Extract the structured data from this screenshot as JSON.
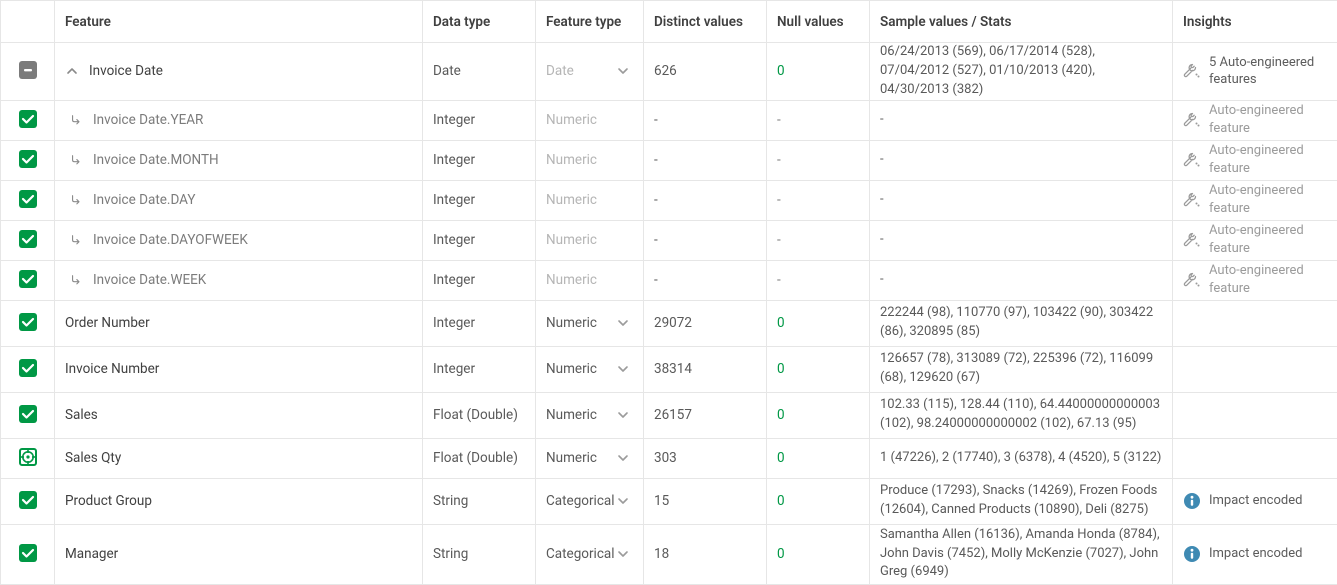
{
  "columns": {
    "feature": "Feature",
    "datatype": "Data type",
    "featuretype": "Feature type",
    "distinct": "Distinct values",
    "nulls": "Null values",
    "sample": "Sample values / Stats",
    "insights": "Insights"
  },
  "rows": [
    {
      "kind": "parent",
      "check": "indeterminate",
      "feature": "Invoice Date",
      "datatype": "Date",
      "featuretype": "Date",
      "ft_disabled": true,
      "ft_chevron": true,
      "distinct": "626",
      "nulls": "0",
      "sample": "06/24/2013 (569), 06/17/2014 (528), 07/04/2012 (527), 01/10/2013 (420), 04/30/2013 (382)",
      "insight": {
        "icon": "wrench",
        "text": "5 Auto-engineered features"
      },
      "rowcls": "tall"
    },
    {
      "kind": "child",
      "check": "checked",
      "feature": "Invoice Date.YEAR",
      "datatype": "Integer",
      "featuretype": "Numeric",
      "ft_disabled": true,
      "ft_chevron": false,
      "distinct": "-",
      "nulls": "-",
      "sample": "-",
      "insight": {
        "icon": "wrench",
        "text": "Auto-engineered feature",
        "dim": true
      },
      "dimrow": true
    },
    {
      "kind": "child",
      "check": "checked",
      "feature": "Invoice Date.MONTH",
      "datatype": "Integer",
      "featuretype": "Numeric",
      "ft_disabled": true,
      "ft_chevron": false,
      "distinct": "-",
      "nulls": "-",
      "sample": "-",
      "insight": {
        "icon": "wrench",
        "text": "Auto-engineered feature",
        "dim": true
      },
      "dimrow": true
    },
    {
      "kind": "child",
      "check": "checked",
      "feature": "Invoice Date.DAY",
      "datatype": "Integer",
      "featuretype": "Numeric",
      "ft_disabled": true,
      "ft_chevron": false,
      "distinct": "-",
      "nulls": "-",
      "sample": "-",
      "insight": {
        "icon": "wrench",
        "text": "Auto-engineered feature",
        "dim": true
      },
      "dimrow": true
    },
    {
      "kind": "child",
      "check": "checked",
      "feature": "Invoice Date.DAYOFWEEK",
      "datatype": "Integer",
      "featuretype": "Numeric",
      "ft_disabled": true,
      "ft_chevron": false,
      "distinct": "-",
      "nulls": "-",
      "sample": "-",
      "insight": {
        "icon": "wrench",
        "text": "Auto-engineered feature",
        "dim": true
      },
      "dimrow": true
    },
    {
      "kind": "child",
      "check": "checked",
      "feature": "Invoice Date.WEEK",
      "datatype": "Integer",
      "featuretype": "Numeric",
      "ft_disabled": true,
      "ft_chevron": false,
      "distinct": "-",
      "nulls": "-",
      "sample": "-",
      "insight": {
        "icon": "wrench",
        "text": "Auto-engineered feature",
        "dim": true
      },
      "dimrow": true
    },
    {
      "kind": "normal",
      "check": "checked",
      "feature": "Order Number",
      "datatype": "Integer",
      "featuretype": "Numeric",
      "ft_disabled": false,
      "ft_chevron": true,
      "distinct": "29072",
      "nulls": "0",
      "sample": "222244 (98), 110770 (97), 103422 (90), 303422 (86), 320895 (85)",
      "insight": null,
      "rowcls": "tall"
    },
    {
      "kind": "normal",
      "check": "checked",
      "feature": "Invoice Number",
      "datatype": "Integer",
      "featuretype": "Numeric",
      "ft_disabled": false,
      "ft_chevron": true,
      "distinct": "38314",
      "nulls": "0",
      "sample": "126657 (78), 313089 (72), 225396 (72), 116099 (68), 129620 (67)",
      "insight": null,
      "rowcls": "tall"
    },
    {
      "kind": "normal",
      "check": "checked",
      "feature": "Sales",
      "datatype": "Float (Double)",
      "featuretype": "Numeric",
      "ft_disabled": false,
      "ft_chevron": true,
      "distinct": "26157",
      "nulls": "0",
      "sample": "102.33 (115), 128.44 (110), 64.44000000000003 (102), 98.24000000000002 (102), 67.13 (95)",
      "insight": null,
      "rowcls": "tall"
    },
    {
      "kind": "normal",
      "check": "target",
      "feature": "Sales Qty",
      "datatype": "Float (Double)",
      "featuretype": "Numeric",
      "ft_disabled": false,
      "ft_chevron": true,
      "distinct": "303",
      "nulls": "0",
      "sample": "1 (47226), 2 (17740), 3 (6378), 4 (4520), 5 (3122)",
      "insight": null
    },
    {
      "kind": "normal",
      "check": "checked",
      "feature": "Product Group",
      "datatype": "String",
      "featuretype": "Categorical",
      "ft_disabled": false,
      "ft_chevron": true,
      "distinct": "15",
      "nulls": "0",
      "sample": "Produce (17293), Snacks (14269), Frozen Foods (12604), Canned Products (10890), Deli (8275)",
      "insight": {
        "icon": "info",
        "text": "Impact encoded"
      },
      "rowcls": "tall"
    },
    {
      "kind": "normal",
      "check": "checked",
      "feature": "Manager",
      "datatype": "String",
      "featuretype": "Categorical",
      "ft_disabled": false,
      "ft_chevron": true,
      "distinct": "18",
      "nulls": "0",
      "sample": "Samantha Allen (16136), Amanda Honda (8784), John Davis (7452), Molly McKenzie (7027), John Greg (6949)",
      "insight": {
        "icon": "info",
        "text": "Impact encoded"
      },
      "rowcls": "tall3"
    }
  ]
}
